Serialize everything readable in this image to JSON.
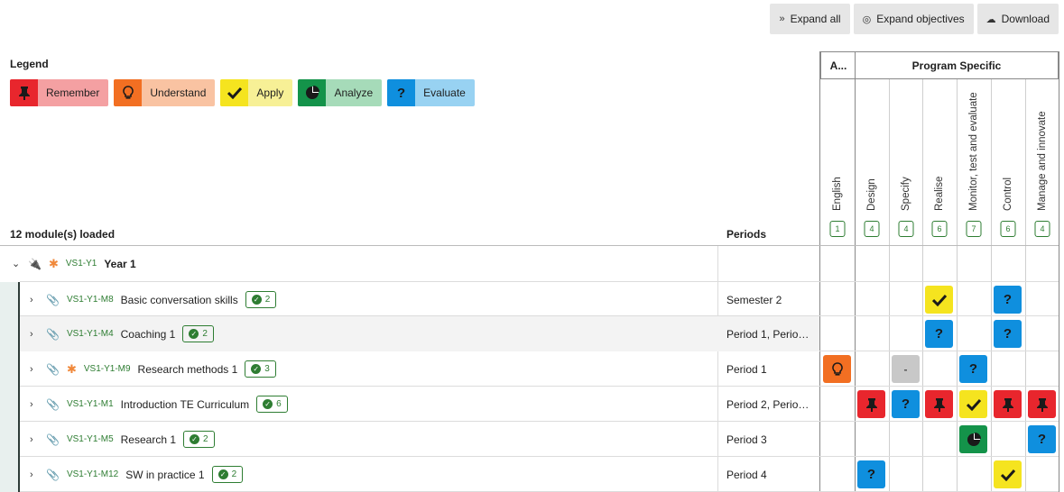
{
  "toolbar": {
    "expand_all": "Expand all",
    "expand_objectives": "Expand objectives",
    "download": "Download"
  },
  "legend": {
    "title": "Legend",
    "items": [
      {
        "label": "Remember",
        "icon": "pin-icon",
        "color": "#e8262d",
        "bg": "#f4a0a2"
      },
      {
        "label": "Understand",
        "icon": "lightbulb-icon",
        "color": "#f26f22",
        "bg": "#f9c3a2"
      },
      {
        "label": "Apply",
        "icon": "check-icon",
        "color": "#f5e41f",
        "bg": "#f7f096"
      },
      {
        "label": "Analyze",
        "icon": "pie-chart-icon",
        "color": "#14934a",
        "bg": "#a6dbb9"
      },
      {
        "label": "Evaluate",
        "icon": "question-icon",
        "color": "#0f8fde",
        "bg": "#98d2f2"
      }
    ]
  },
  "table": {
    "loaded_text": "12 module(s) loaded",
    "periods_header": "Periods",
    "groups": [
      {
        "label": "A..."
      },
      {
        "label": "Program Specific"
      }
    ],
    "columns": [
      {
        "name": "English",
        "count": "1"
      },
      {
        "name": "Design",
        "count": "4"
      },
      {
        "name": "Specify",
        "count": "4"
      },
      {
        "name": "Realise",
        "count": "6"
      },
      {
        "name": "Monitor, test and evaluate",
        "count": "7"
      },
      {
        "name": "Control",
        "count": "6"
      },
      {
        "name": "Manage and innovate",
        "count": "4"
      }
    ],
    "year_row": {
      "code": "VS1-Y1",
      "title": "Year 1"
    },
    "rows": [
      {
        "code": "VS1-Y1-M8",
        "title": "Basic conversation skills",
        "objectives": "2",
        "period": "Semester 2",
        "starred": false,
        "cells": [
          "",
          "",
          "",
          "apply",
          "",
          "evaluate",
          ""
        ]
      },
      {
        "code": "VS1-Y1-M4",
        "title": "Coaching 1",
        "objectives": "2",
        "period": "Period 1, Perio…",
        "starred": false,
        "cells": [
          "",
          "",
          "",
          "evaluate",
          "",
          "evaluate",
          ""
        ]
      },
      {
        "code": "VS1-Y1-M9",
        "title": "Research methods 1",
        "objectives": "3",
        "period": "Period 1",
        "starred": true,
        "cells": [
          "understand",
          "",
          "none",
          "",
          "evaluate",
          "",
          ""
        ]
      },
      {
        "code": "VS1-Y1-M1",
        "title": "Introduction TE Curriculum",
        "objectives": "6",
        "period": "Period 2, Perio…",
        "starred": false,
        "cells": [
          "",
          "remember",
          "evaluate",
          "remember",
          "apply",
          "remember",
          "remember"
        ]
      },
      {
        "code": "VS1-Y1-M5",
        "title": "Research 1",
        "objectives": "2",
        "period": "Period 3",
        "starred": false,
        "cells": [
          "",
          "",
          "",
          "",
          "analyze",
          "",
          "evaluate"
        ]
      },
      {
        "code": "VS1-Y1-M12",
        "title": "SW in practice 1",
        "objectives": "2",
        "period": "Period 4",
        "starred": false,
        "cells": [
          "",
          "evaluate",
          "",
          "",
          "",
          "apply",
          ""
        ]
      }
    ],
    "none_symbol": "-"
  }
}
